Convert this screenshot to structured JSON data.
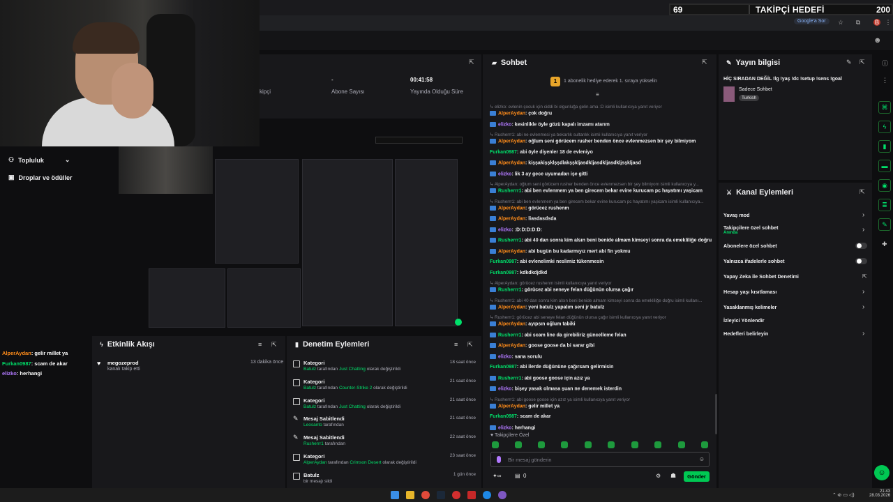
{
  "goal": {
    "current": "69",
    "title": "TAKİPÇİ HEDEFİ",
    "target": "200",
    "progress_fraction": 0.345
  },
  "browser": {
    "google_label": "Google'a Sor"
  },
  "stats": {
    "followers_label": "kipçi",
    "subs_value": "-",
    "subs_label": "Abone Sayısı",
    "uptime_value": "00:41:58",
    "uptime_label": "Yayında Olduğu Süre"
  },
  "leftnav": {
    "topluluk": "Topluluk",
    "droplar": "Droplar ve ödüller"
  },
  "overlay_chat": [
    {
      "user": "AlperAydan",
      "color": "#ff8c1a",
      "msg": ": gelir millet ya"
    },
    {
      "user": "Furkan0987",
      "color": "#00e06a",
      "msg": ": scam de akar"
    },
    {
      "user": "elizko",
      "color": "#b279ff",
      "msg": ": herhangi"
    }
  ],
  "chat": {
    "title": "Sohbet",
    "hype_text": "1 abonelik hediye ederek 1. sıraya yükselin",
    "placeholder": "Bir mesaj gönderin",
    "followers_only": "Takipçilere Özel",
    "points": "0",
    "send_label": "Gönder",
    "messages": [
      {
        "reply": "elizko: evlenin çocuk için ciddi bi olgunluğa gelin ama :D isimli kullanıcıya yanıt veriyor",
        "user": "AlperAydan",
        "color": "#ff8c1a",
        "badge": true,
        "text": ": çok doğru"
      },
      {
        "reply": "",
        "user": "elizko",
        "color": "#b279ff",
        "badge": true,
        "text": ": kesinlikle öyle gözü kapalı imzamı atarım"
      },
      {
        "reply": "Rusherrr1: abi ne evlenmesi ya bekarlık sultanlık isimli kullanıcıya yanıt veriyor",
        "user": "AlperAydan",
        "color": "#ff8c1a",
        "badge": true,
        "text": ": oğlum seni görücem rusher benden önce evlenmezsen bir şey bilmiyom"
      },
      {
        "reply": "",
        "user": "Furkan0987",
        "color": "#00e06a",
        "badge": false,
        "text": ": abi öyle diyenler 18 de evleniyo"
      },
      {
        "reply": "",
        "user": "AlperAydan",
        "color": "#ff8c1a",
        "badge": true,
        "text": ": kişşakişşklşşdlakşşkljasdkljasdkljasdkljsşkljasd"
      },
      {
        "reply": "",
        "user": "elizko",
        "color": "#b279ff",
        "badge": true,
        "text": ": lik 3 ay gece uyumadan işe gitti"
      },
      {
        "reply": "AlperAydan: oğlum seni görücem rusher benden önce evlenmezsen bir şey bilmiyom isimli kullanıcıya y...",
        "user": "Rusherrr1",
        "color": "#00e06a",
        "badge": true,
        "text": ": abi ben evlenmem ya ben girecem bekar evine kurucam pc hayatımı yaşicam"
      },
      {
        "reply": "Rusherrr1: abi ben evlenmem ya ben girecem bekar evine kurucam pc hayatımı yaşicam isimli kullanıcıya...",
        "user": "AlperAydan",
        "color": "#ff8c1a",
        "badge": true,
        "text": ": görücez rushenm"
      },
      {
        "reply": "",
        "user": "AlperAydan",
        "color": "#ff8c1a",
        "badge": true,
        "text": ": liasdasdsda"
      },
      {
        "reply": "",
        "user": "elizko",
        "color": "#b279ff",
        "badge": true,
        "text": ": :D:D:D:D:D:"
      },
      {
        "reply": "",
        "user": "Rusherrr1",
        "color": "#00e06a",
        "badge": true,
        "text": ": abi 40 dan sonra kim alsın beni benide almam kimseyi sonra da emekliliğe doğru"
      },
      {
        "reply": "",
        "user": "AlperAydan",
        "color": "#ff8c1a",
        "badge": true,
        "text": ": abi bugün bu kadarmıyız mert abi fin yokmu"
      },
      {
        "reply": "",
        "user": "Furkan0987",
        "color": "#00e06a",
        "badge": false,
        "text": ": abi evlenelimki neslimiz tükenmesin"
      },
      {
        "reply": "",
        "user": "Furkan0987",
        "color": "#00e06a",
        "badge": false,
        "text": ": kdkdkdjdkd"
      },
      {
        "reply": "AlperAydan: görücez rushenm isimli kullanıcıya yanıt veriyor",
        "user": "Rusherrr1",
        "color": "#00e06a",
        "badge": true,
        "text": ": görücez abi seneye felan düğünün olursa çağır"
      },
      {
        "reply": "Rusherrr1: abi 40 dan sonra kim alsın beni benide almam kimseyi sonra da emekliliğe doğru isimli kullanı...",
        "user": "AlperAydan",
        "color": "#ff8c1a",
        "badge": true,
        "text": ": yeni batulz yapalım seni jr batulz"
      },
      {
        "reply": "Rusherrr1: görücez abi seneye felan düğünün olursa çağır isimli kullanıcıya yanıt veriyor",
        "user": "AlperAydan",
        "color": "#ff8c1a",
        "badge": true,
        "text": ": ayıpsın oğlum tabiki"
      },
      {
        "reply": "",
        "user": "Rusherrr1",
        "color": "#00e06a",
        "badge": true,
        "text": ": abi scam line da girebiliriz güncelleme felan"
      },
      {
        "reply": "",
        "user": "AlperAydan",
        "color": "#ff8c1a",
        "badge": true,
        "text": ": goose goose da bi sarar gibi"
      },
      {
        "reply": "",
        "user": "elizko",
        "color": "#b279ff",
        "badge": true,
        "text": ": sana sorulu"
      },
      {
        "reply": "",
        "user": "Furkan0987",
        "color": "#00e06a",
        "badge": false,
        "text": ": abi ilerde düğününe çağırsam gelirmisin"
      },
      {
        "reply": "",
        "user": "Rusherrr1",
        "color": "#00e06a",
        "badge": true,
        "text": ": abi goose goose için azız ya"
      },
      {
        "reply": "",
        "user": "elizko",
        "color": "#b279ff",
        "badge": true,
        "text": ": bişey yasak olmasa şuan ne denemek isterdin"
      },
      {
        "reply": "Rusherrr1: abi goose goose için azız ya isimli kullanıcıya yanıt veriyor",
        "user": "AlperAydan",
        "color": "#ff8c1a",
        "badge": true,
        "text": ": gelir millet ya"
      },
      {
        "reply": "",
        "user": "Furkan0987",
        "color": "#00e06a",
        "badge": false,
        "text": ": scam de akar"
      },
      {
        "reply": "",
        "user": "elizko",
        "color": "#b279ff",
        "badge": true,
        "text": ": herhangi"
      }
    ]
  },
  "stream_info": {
    "title": "Yayın bilgisi",
    "stream_title": "HİÇ SIRADAN DEĞİL !lg !yaş !dc !setup !sens !goal",
    "category": "Sadece Sohbet",
    "language": "Turkish"
  },
  "kanal": {
    "title": "Kanal Eylemleri",
    "items": [
      {
        "label": "Yavaş mod",
        "control": "chevron"
      },
      {
        "label": "Takipçilere özel sohbet",
        "sub": "Anında",
        "control": "chevron"
      },
      {
        "label": "Abonelere özel sohbet",
        "control": "toggle"
      },
      {
        "label": "Yalnızca ifadelerle sohbet",
        "control": "toggle"
      },
      {
        "label": "Yapay Zeka ile Sohbet Denetimi",
        "control": "external"
      },
      {
        "label": "Hesap yaşı kısıtlaması",
        "control": "chevron"
      },
      {
        "label": "Yasaklanmış kelimeler",
        "control": "chevron"
      },
      {
        "label": "İzleyici Yönlendir",
        "control": "none"
      },
      {
        "label": "Hedefleri belirleyin",
        "control": "chevron"
      }
    ]
  },
  "etkinlik": {
    "title": "Etkinlik Akışı",
    "user": "megozeprod",
    "action": "kanalı takip etti",
    "time": "13 dakika önce"
  },
  "denetim": {
    "title": "Denetim Eylemleri",
    "rows": [
      {
        "title": "Kategori",
        "who": "Batulz",
        "mid": " tarafından ",
        "what": "Just Chatting",
        "tail": " olarak değiştirildi",
        "time": "18 saat önce"
      },
      {
        "title": "Kategori",
        "who": "Batulz",
        "mid": " tarafından ",
        "what": "Counter-Strike 2",
        "tail": " olarak değiştirildi",
        "time": "21 saat önce"
      },
      {
        "title": "Kategori",
        "who": "Batulz",
        "mid": " tarafından ",
        "what": "Just Chatting",
        "tail": " olarak değiştirildi",
        "time": "21 saat önce"
      },
      {
        "title": "Mesaj Sabitlendi",
        "who": "Leosanto",
        "mid": " tarafından",
        "what": "",
        "tail": "",
        "time": "21 saat önce"
      },
      {
        "title": "Mesaj Sabitlendi",
        "who": "Rusherrr1",
        "mid": " tarafından",
        "what": "",
        "tail": "",
        "time": "22 saat önce"
      },
      {
        "title": "Kategori",
        "who": "AlperAydan",
        "mid": " tarafından ",
        "what": "Crimson Desert",
        "tail": " olarak değiştirildi",
        "time": "23 saat önce"
      },
      {
        "title": "Batulz",
        "who": "",
        "mid": "bir mesajı sildi",
        "what": "",
        "tail": "",
        "time": "1 gün önce"
      }
    ]
  },
  "taskbar": {
    "time": "21:43",
    "date": "28.03.2026"
  }
}
